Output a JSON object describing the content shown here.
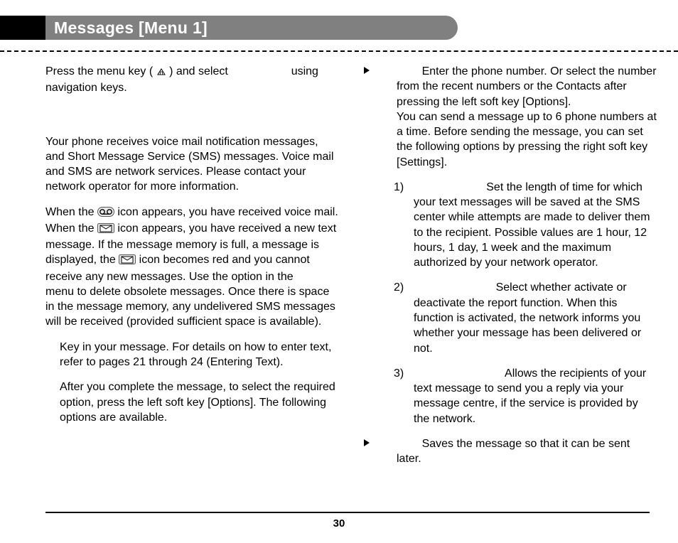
{
  "header": {
    "title": "Messages [Menu 1]"
  },
  "left_col": {
    "intro_pre": "Press the menu key (",
    "intro_post_icon": ") and select",
    "intro_tail": "using navigation keys.",
    "para1": "Your phone receives voice mail notification messages, and Short Message Service (SMS) messages. Voice mail and SMS are network services. Please contact your network operator for more information.",
    "para2_pre": "When the",
    "para2_after_vm": "icon appears, you have received voice mail. When the",
    "para2_after_env1": "icon appears, you have received a new text message. If the message memory is full, a message is displayed, the",
    "para2_after_env2": "icon becomes red and you cannot receive any new messages. Use the option in the",
    "para2_tail": "menu to delete obsolete messages. Once there is space in the message memory, any undelivered SMS messages will be received (provided sufficient space is available).",
    "step1": "Key in your message. For details on how to enter text, refer to pages 21 through 24 (Entering Text).",
    "step2": "After you complete the message, to select the required option, press the left soft key [Options]. The following options are available."
  },
  "right_col": {
    "bullet1_a": "Enter the phone number. Or select the number from the recent numbers or the Contacts after pressing the left soft key [Options].",
    "bullet1_b": "You can send a message up to 6 phone numbers at a time. Before sending the message, you can set the following options by pressing the right soft key [Settings].",
    "opt1_num": "1)",
    "opt1": "Set the length of time for which your text messages will be saved at the SMS center while attempts are made to deliver them to the recipient. Possible values are 1 hour, 12 hours, 1 day, 1 week and the maximum authorized by your network operator.",
    "opt2_num": "2)",
    "opt2": "Select whether activate or deactivate the report function. When this function is activated, the network informs you whether your message has been delivered or not.",
    "opt3_num": "3)",
    "opt3": "Allows the recipients of your text message to send you a reply via your message centre, if the service is provided by the network.",
    "bullet2": "Saves the message so that it can be sent later."
  },
  "footer": {
    "page": "30"
  }
}
